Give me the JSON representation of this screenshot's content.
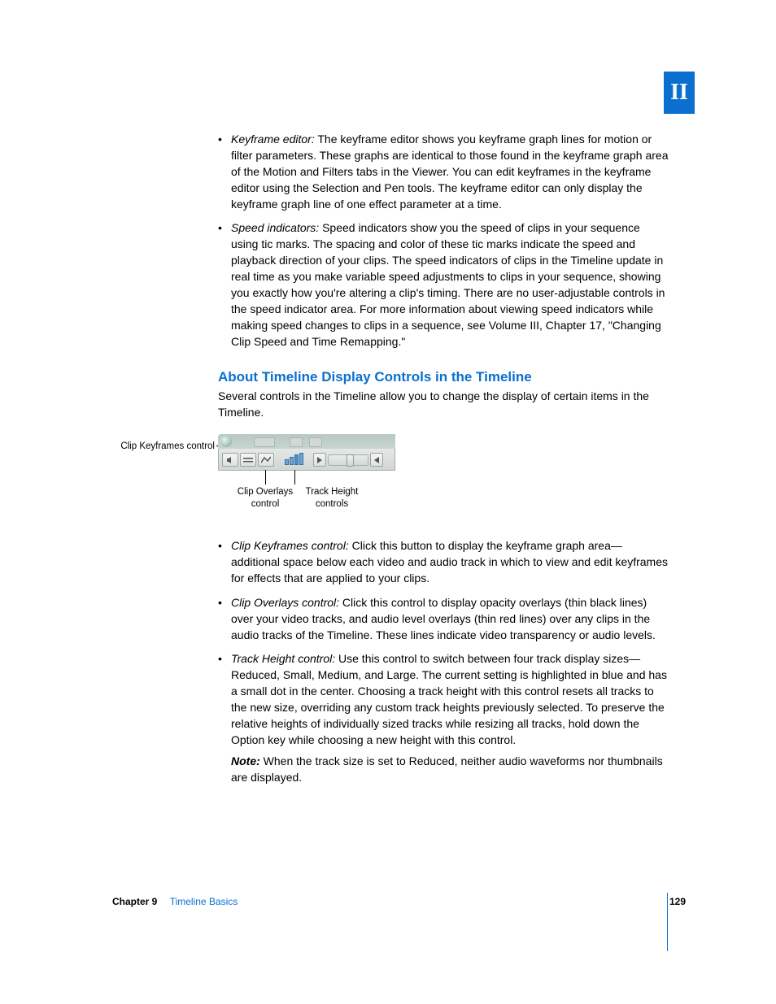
{
  "section_marker": "II",
  "bullets_top": [
    {
      "term": "Keyframe editor:",
      "text": "  The keyframe editor shows you keyframe graph lines for motion or filter parameters. These graphs are identical to those found in the keyframe graph area of the Motion and Filters tabs in the Viewer. You can edit keyframes in the keyframe editor using the Selection and Pen tools. The keyframe editor can only display the keyframe graph line of one effect parameter at a time."
    },
    {
      "term": "Speed indicators:",
      "text": "  Speed indicators show you the speed of clips in your sequence using tic marks. The spacing and color of these tic marks indicate the speed and playback direction of your clips. The speed indicators of clips in the Timeline update in real time as you make variable speed adjustments to clips in your sequence, showing you exactly how you're altering a clip's timing. There are no user-adjustable controls in the speed indicator area. For more information about viewing speed indicators while making speed changes to clips in a sequence, see Volume III, Chapter 17, \"Changing Clip Speed and Time Remapping.\""
    }
  ],
  "section_heading": "About Timeline Display Controls in the Timeline",
  "section_intro": "Several controls in the Timeline allow you to change the display of certain items in the Timeline.",
  "figure": {
    "callouts": {
      "left": "Clip Keyframes control",
      "bottom_left": "Clip Overlays control",
      "bottom_right": "Track Height controls"
    }
  },
  "bullets_bottom": [
    {
      "term": "Clip Keyframes control:",
      "text": "  Click this button to display the keyframe graph area—additional space below each video and audio track in which to view and edit keyframes for effects that are applied to your clips."
    },
    {
      "term": "Clip Overlays control:",
      "text": "  Click this control to display opacity overlays (thin black lines) over your video tracks, and audio level overlays (thin red lines) over any clips in the audio tracks of the Timeline. These lines indicate video transparency or audio levels."
    },
    {
      "term": "Track Height control:",
      "text": "  Use this control to switch between four track display sizes—Reduced, Small, Medium, and Large. The current setting is highlighted in blue and has a small dot in the center. Choosing a track height with this control resets all tracks to the new size, overriding any custom track heights previously selected. To preserve the relative heights of individually sized tracks while resizing all tracks, hold down the Option key while choosing a new height with this control."
    }
  ],
  "note_label": "Note:",
  "note_text": "  When the track size is set to Reduced, neither audio waveforms nor thumbnails are displayed.",
  "footer": {
    "chapter": "Chapter 9",
    "title": "Timeline Basics",
    "page": "129"
  }
}
